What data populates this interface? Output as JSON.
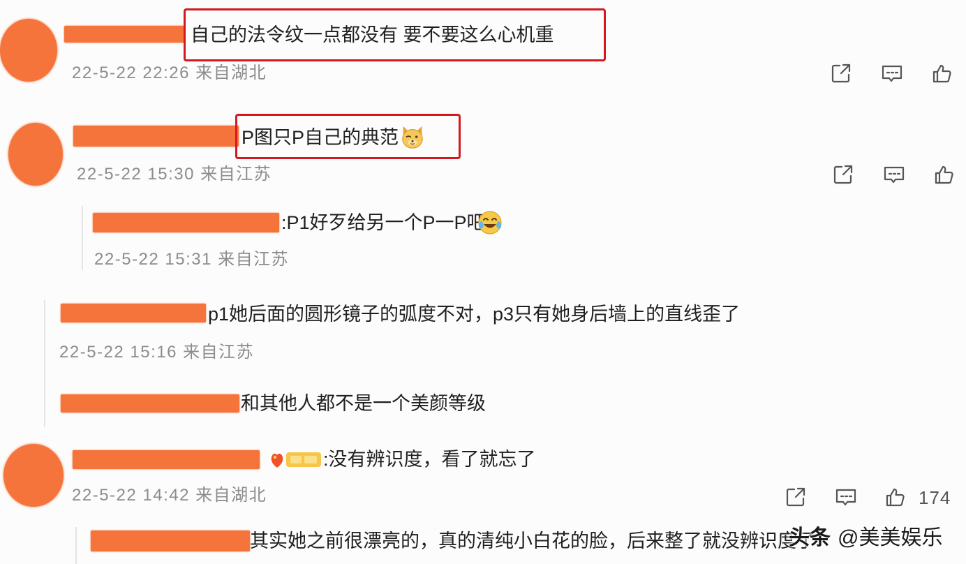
{
  "colors": {
    "redaction": "#f4743b",
    "highlight_box": "#d4181f",
    "text": "#1f1f1f",
    "meta": "#8c8c8c",
    "icon": "#555555",
    "thread_line": "#e4e4e4"
  },
  "action_icons": [
    "share-icon",
    "comment-icon",
    "like-icon"
  ],
  "comments": [
    {
      "text": "自己的法令纹一点都没有 要不要这么心机重",
      "time": "22-5-22 22:26",
      "source": "来自湖北"
    },
    {
      "text": "P图只P自己的典范",
      "emoji": "doge-emoji",
      "time": "22-5-22 15:30",
      "source": "来自江苏",
      "replies": [
        {
          "text": ":P1好歹给另一个P一P吧",
          "emoji": "laugh-cry-emoji",
          "time": "22-5-22 15:31",
          "source": "来自江苏"
        }
      ]
    },
    {
      "replies": [
        {
          "text": "p1她后面的圆形镜子的弧度不对，p3只有她身后墙上的直线歪了",
          "time": "22-5-22 15:16",
          "source": "来自江苏"
        },
        {
          "text": "和其他人都不是一个美颜等级"
        }
      ]
    },
    {
      "badge": "fan-badge",
      "text": ":没有辨识度，看了就忘了",
      "time": "22-5-22 14:42",
      "source": "来自湖北",
      "likes": "174",
      "replies": [
        {
          "text": "其实她之前很漂亮的，真的清纯小白花的脸，后来整了就没辨识度了"
        }
      ]
    }
  ],
  "watermark": {
    "platform": "头条",
    "account": "@美美娱乐"
  }
}
